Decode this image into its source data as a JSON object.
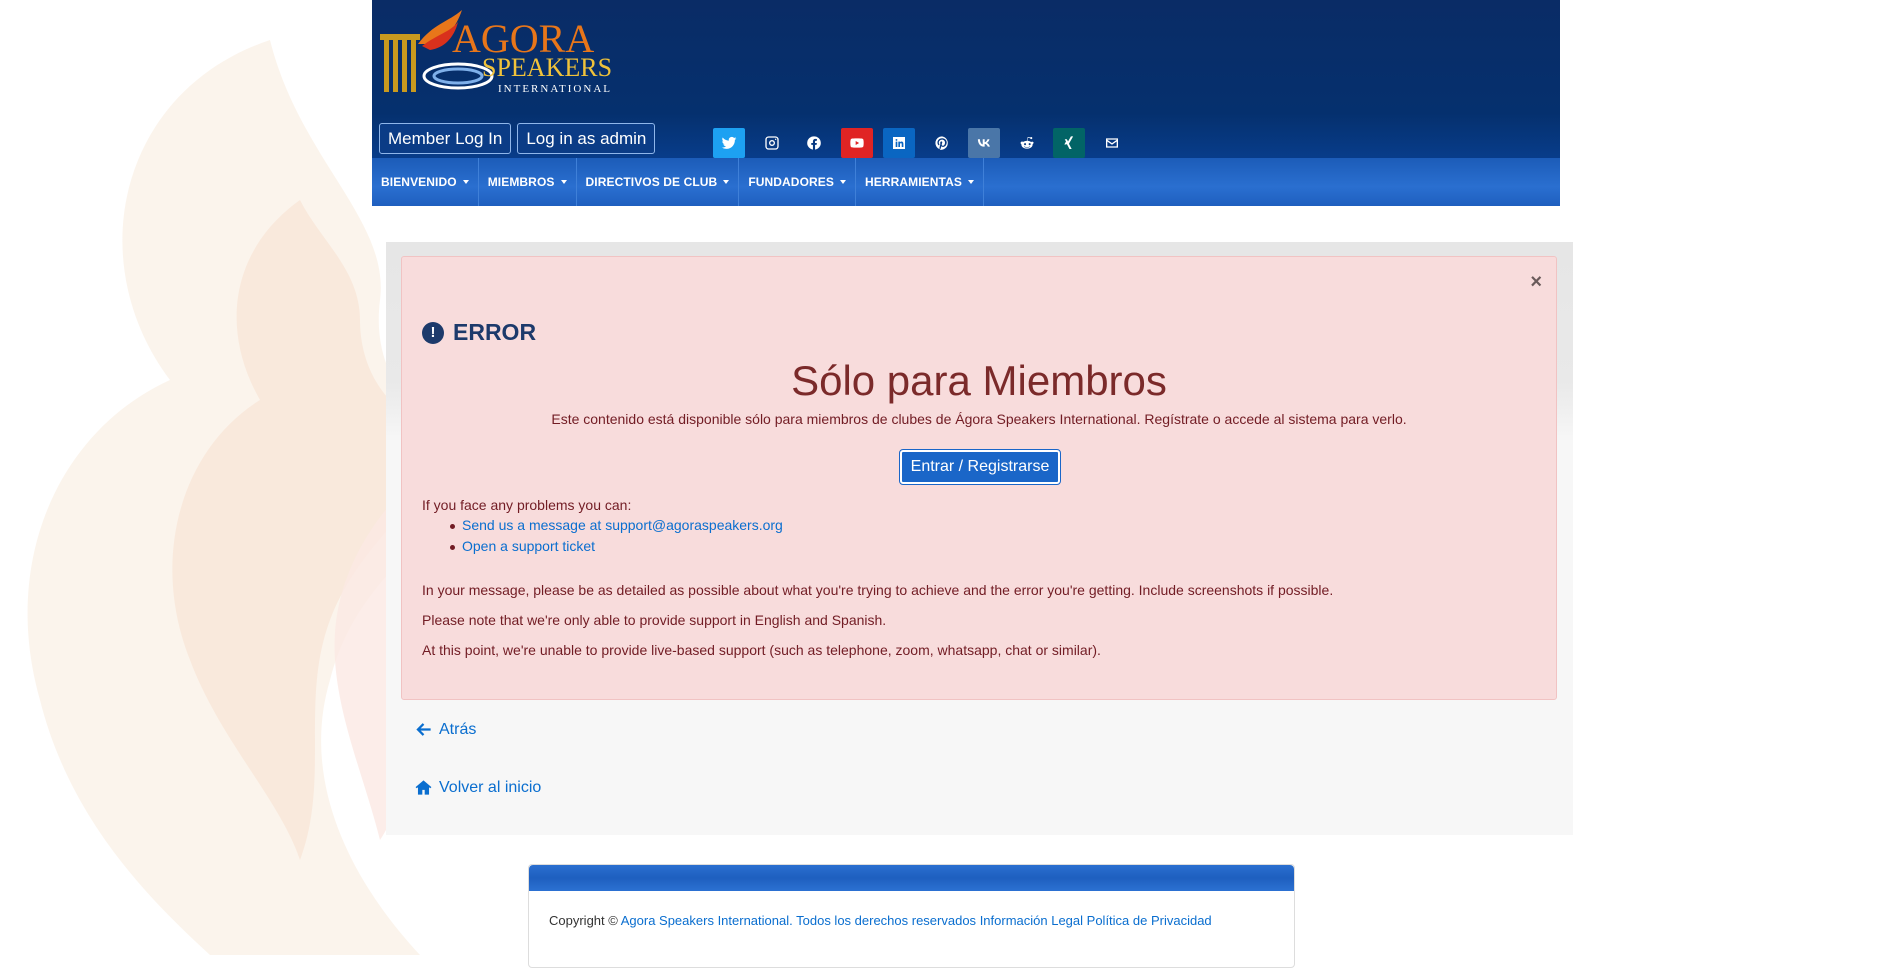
{
  "colors": {
    "header_dark": "#05306e",
    "nav_blue": "#2a6fd0",
    "alert_bg": "#f8dcdc",
    "alert_text": "#721c24",
    "link": "#0a6ecf",
    "twitter": "#1da1f2",
    "youtube": "#e02424",
    "linkedin": "#0a66c2",
    "vk": "#4a76a8",
    "xing": "#026466"
  },
  "header": {
    "logo_line1": "AGORA",
    "logo_line2": "SPEAKERS",
    "logo_line3": "INTERNATIONAL",
    "member_login": "Member Log In",
    "admin_login": "Log in as admin",
    "social": [
      "twitter-icon",
      "instagram-icon",
      "facebook-icon",
      "youtube-icon",
      "linkedin-icon",
      "pinterest-icon",
      "vk-icon",
      "reddit-icon",
      "xing-icon",
      "email-icon"
    ]
  },
  "nav": {
    "items": [
      "BIENVENIDO",
      "MIEMBROS",
      "DIRECTIVOS DE CLUB",
      "FUNDADORES",
      "HERRAMIENTAS"
    ]
  },
  "alert": {
    "close": "×",
    "error_label": "ERROR",
    "headline": "Sólo para Miembros",
    "description": "Este contenido está disponible sólo para miembros de clubes de Ágora Speakers International. Regístrate o accede al sistema para verlo.",
    "cta": "Entrar / Registrarse",
    "help_intro": "If you face any problems you can:",
    "help_items": [
      "Send us a message at support@agoraspeakers.org",
      "Open a support ticket"
    ],
    "p1": "In your message, please be as detailed as possible about what you're trying to achieve and the error you're getting. Include screenshots if possible.",
    "p2": "Please note that we're only able to provide support in English and Spanish.",
    "p3": "At this point, we're unable to provide live-based support (such as telephone, zoom, whatsapp, chat or similar)."
  },
  "links": {
    "back": "Atrás",
    "home": "Volver al inicio"
  },
  "footer": {
    "copyright": "Copyright ©",
    "org": "Agora Speakers International.",
    "rights": "Todos los derechos reservados",
    "legal": "Información Legal",
    "privacy": "Política de Privacidad"
  }
}
